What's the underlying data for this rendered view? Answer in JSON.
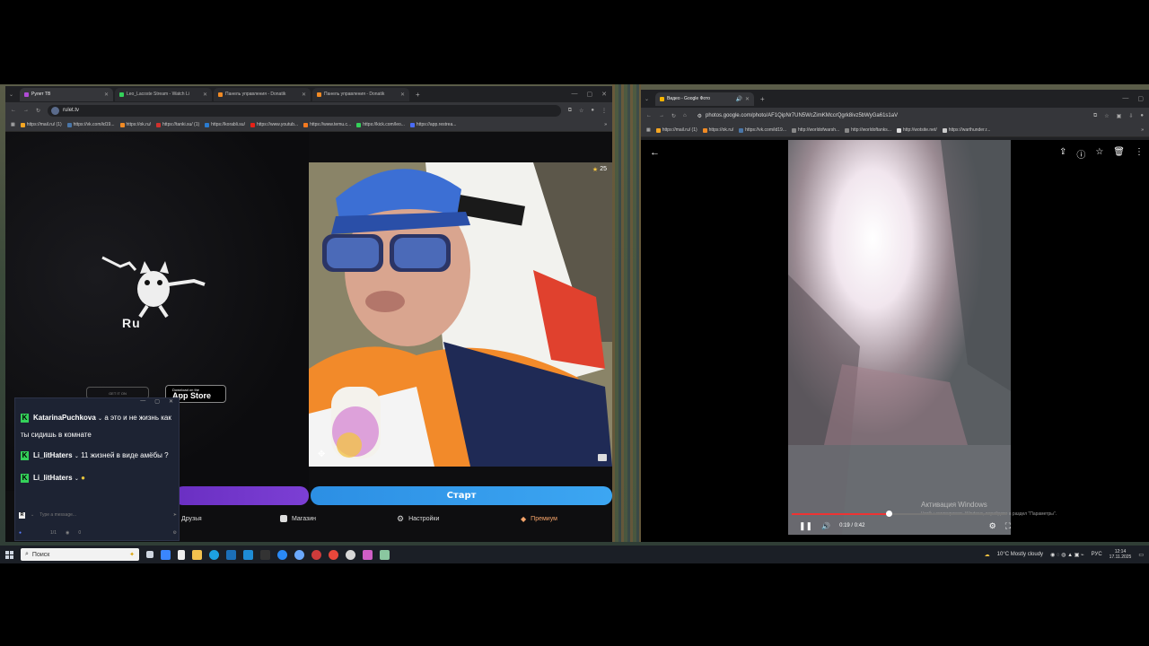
{
  "left_browser": {
    "tabs": [
      {
        "label": "Рулет ТВ",
        "color": "#b04bd6",
        "active": true
      },
      {
        "label": "Leo_Lacoste Stream - Watch Li",
        "color": "#34d15a",
        "active": false
      },
      {
        "label": "Панель управления - Donatik",
        "color": "#f08a24",
        "active": false
      },
      {
        "label": "Панель управления - Donatik",
        "color": "#f08a24",
        "active": false
      }
    ],
    "url": "rulet.tv",
    "bookmarks": [
      {
        "label": "https://mail.ru/ (1)",
        "color": "#f5a623"
      },
      {
        "label": "https://vk.com/id19...",
        "color": "#4a76a8"
      },
      {
        "label": "https://ok.ru/",
        "color": "#f08a24"
      },
      {
        "label": "https://tanki.su/ (1)",
        "color": "#d0312d"
      },
      {
        "label": "https://korabli.su/",
        "color": "#2a7bd0"
      },
      {
        "label": "https://www.youtub...",
        "color": "#e62117"
      },
      {
        "label": "https://www.temu.c...",
        "color": "#f57a1f"
      },
      {
        "label": "https://kick.com/leo...",
        "color": "#34d15a"
      },
      {
        "label": "https://app.restrea...",
        "color": "#4a6cf7"
      }
    ]
  },
  "rulet": {
    "logo_text": "Ru",
    "appstore_small": "Download on the",
    "appstore_big": "App Store",
    "appstore_left": "GET IT ON",
    "cam_count": "25",
    "start_button": "Старт",
    "nav": {
      "friends": "Друзья",
      "shop": "Магазин",
      "settings": "Настройки",
      "premium": "Премиум"
    }
  },
  "chat": {
    "messages": [
      {
        "user": "KatarinaPuchkova",
        "text": "а это и не жизнь как ты сидишь в комнате"
      },
      {
        "user": "Li_litHaters",
        "text": "11 жизней в виде амёбы ?"
      },
      {
        "user": "Li_litHaters",
        "text": ""
      }
    ],
    "placeholder": "Type a message...",
    "footer_count": "1/1",
    "footer_viewers": "0"
  },
  "right_browser": {
    "tab_label": "Видео - Google Фото",
    "url": "photos.google.com/photo/AF1QipNr7UN5WcZimKMccrQgrk8ivz5bWyGa61s1aV",
    "bookmarks": [
      {
        "label": "https://mail.ru/ (1)",
        "color": "#f5a623"
      },
      {
        "label": "https://ok.ru/",
        "color": "#f08a24"
      },
      {
        "label": "https://vk.com/id19...",
        "color": "#4a76a8"
      },
      {
        "label": "http://worldofwarsh...",
        "color": "#888888"
      },
      {
        "label": "http://worldoftanks...",
        "color": "#888888"
      },
      {
        "label": "http://wotsite.net/",
        "color": "#dddddd"
      },
      {
        "label": "https://warthunder.r...",
        "color": "#cccccc"
      }
    ],
    "video_time": "0:19 / 0:42",
    "progress": 0.45,
    "activation_title": "Активация Windows",
    "activation_sub": "Чтобы активировать Windows, перейдите в раздел \"Параметры\"."
  },
  "taskbar": {
    "search_placeholder": "Поиск",
    "weather": "10°C  Mostly cloudy",
    "lang": "РУС",
    "time": "12:14",
    "date": "17.11.2025"
  }
}
